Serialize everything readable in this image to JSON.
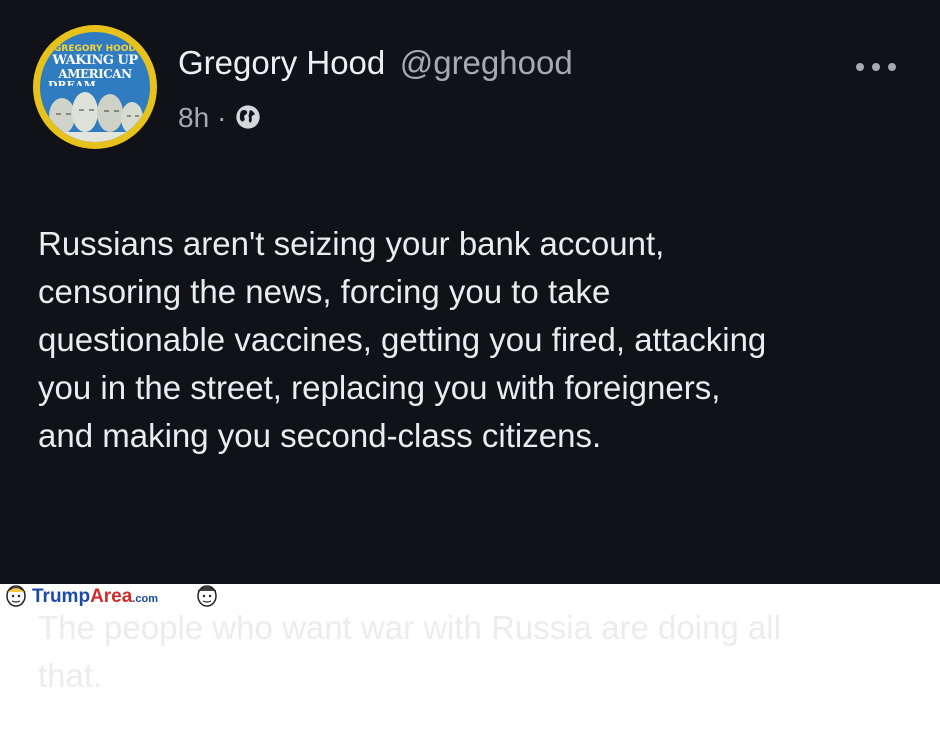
{
  "post": {
    "author": {
      "display_name": "Gregory Hood",
      "handle": "@greghood",
      "avatar": {
        "line1": "GREGORY HOOD",
        "line2": "WAKING UP",
        "line3": "AMERICAN",
        "line4": "DREAM"
      }
    },
    "meta": {
      "time": "8h",
      "separator": "·",
      "visibility_icon": "globe-icon"
    },
    "more_icon": "more-horizontal-icon",
    "text_p1": "Russians aren't seizing your bank account,\ncensoring the news, forcing you to take\nquestionable vaccines, getting you fired, attacking\nyou in the street, replacing you with foreigners,\nand making you second-class citizens.",
    "text_p2": "The people who want war with Russia are doing all\nthat."
  },
  "watermark": {
    "part1": "Trump",
    "part2": "Area",
    "part3": ".com"
  },
  "colors": {
    "background": "#101217",
    "text": "#ececef",
    "muted": "#a7a9b0"
  }
}
